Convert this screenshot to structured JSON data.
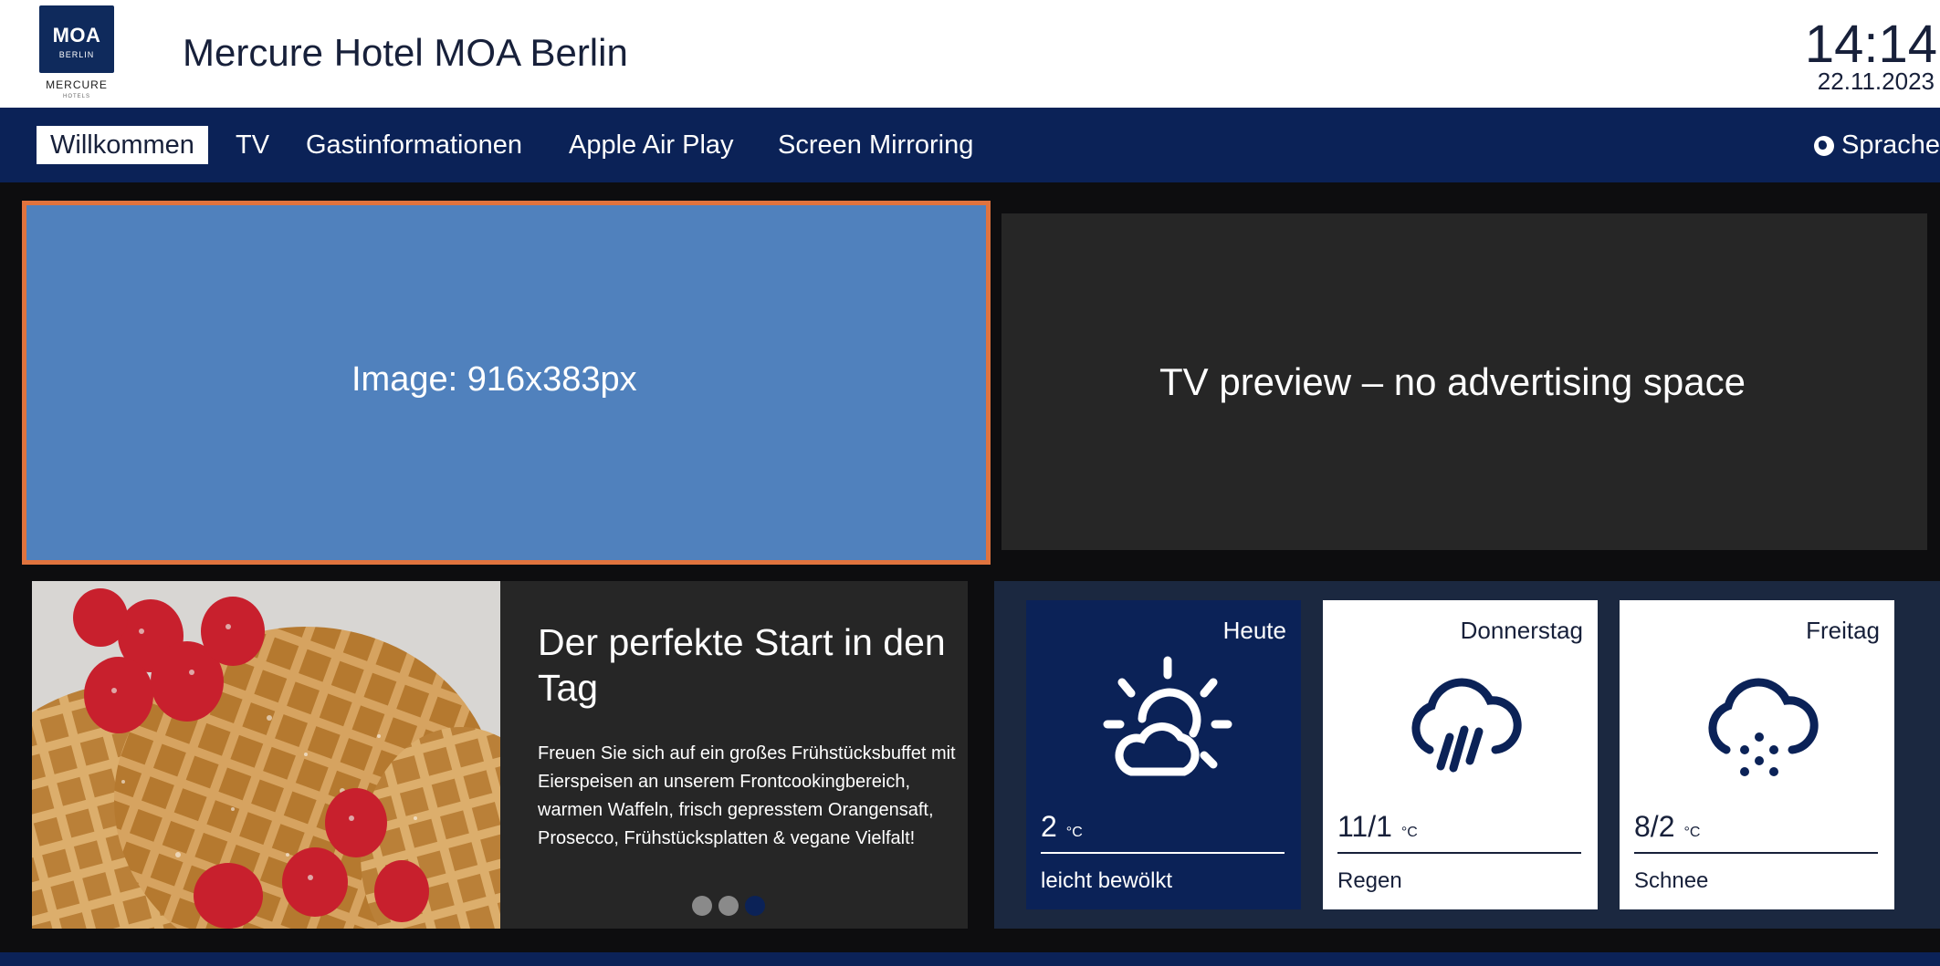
{
  "header": {
    "logo": {
      "main": "MOA",
      "sub": "BERLIN",
      "brand": "MERCURE",
      "brand_sub": "HOTELS"
    },
    "hotel_name": "Mercure Hotel MOA Berlin",
    "time": "14:14",
    "date": "22.11.2023"
  },
  "nav": {
    "items": [
      {
        "label": "Willkommen",
        "active": true
      },
      {
        "label": "TV"
      },
      {
        "label": "Gastinformationen"
      },
      {
        "label": "Apple Air Play"
      },
      {
        "label": "Screen Mirroring"
      }
    ],
    "language_label": "Sprache"
  },
  "main": {
    "image_placeholder": "Image: 916x383px",
    "tv_preview": "TV preview – no advertising space"
  },
  "promo": {
    "title": "Der perfekte Start in den Tag",
    "text": "Freuen Sie sich auf ein großes Frühstücksbuffet mit Eierspeisen an unserem Frontcookingbereich, warmen Waffeln, frisch gepresstem Orangensaft, Prosecco, Frühstücksplatten & vegane Vielfalt!",
    "carousel": {
      "count": 3,
      "active_index": 2
    }
  },
  "weather": {
    "unit": "°C",
    "days": [
      {
        "day": "Heute",
        "temp": "2",
        "condition": "leicht bewölkt",
        "icon": "sun-cloud-icon"
      },
      {
        "day": "Donnerstag",
        "temp": "11/1",
        "condition": "Regen",
        "icon": "rain-cloud-icon"
      },
      {
        "day": "Freitag",
        "temp": "8/2",
        "condition": "Schnee",
        "icon": "snow-cloud-icon"
      }
    ]
  },
  "colors": {
    "navy": "#0b2257",
    "highlight_border": "#e0733e",
    "placeholder_blue": "#5081bd"
  }
}
